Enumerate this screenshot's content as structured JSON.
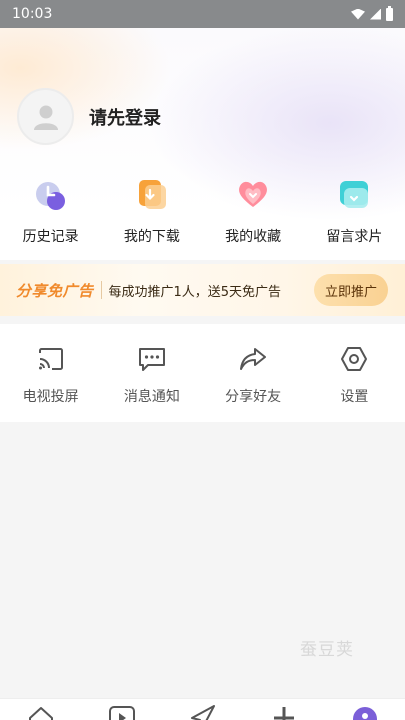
{
  "status_bar": {
    "time": "10:03"
  },
  "profile": {
    "login_prompt": "请先登录"
  },
  "quick_actions": [
    {
      "label": "历史记录",
      "icon": "history-icon"
    },
    {
      "label": "我的下载",
      "icon": "download-icon"
    },
    {
      "label": "我的收藏",
      "icon": "favorite-icon"
    },
    {
      "label": "留言求片",
      "icon": "request-icon"
    }
  ],
  "banner": {
    "tag": "分享免广告",
    "text": "每成功推广1人，送5天免广告",
    "button": "立即推广"
  },
  "tools": [
    {
      "label": "电视投屏",
      "icon": "cast-icon"
    },
    {
      "label": "消息通知",
      "icon": "message-icon"
    },
    {
      "label": "分享好友",
      "icon": "share-icon"
    },
    {
      "label": "设置",
      "icon": "settings-icon"
    }
  ],
  "watermark": "蚕豆荚",
  "tabbar": [
    {
      "icon": "home-icon"
    },
    {
      "icon": "video-icon"
    },
    {
      "icon": "send-icon"
    },
    {
      "icon": "plus-icon"
    },
    {
      "icon": "profile-icon",
      "active": true
    }
  ],
  "colors": {
    "accent_orange": "#f08a2c",
    "active_purple": "#7b5fd8"
  }
}
